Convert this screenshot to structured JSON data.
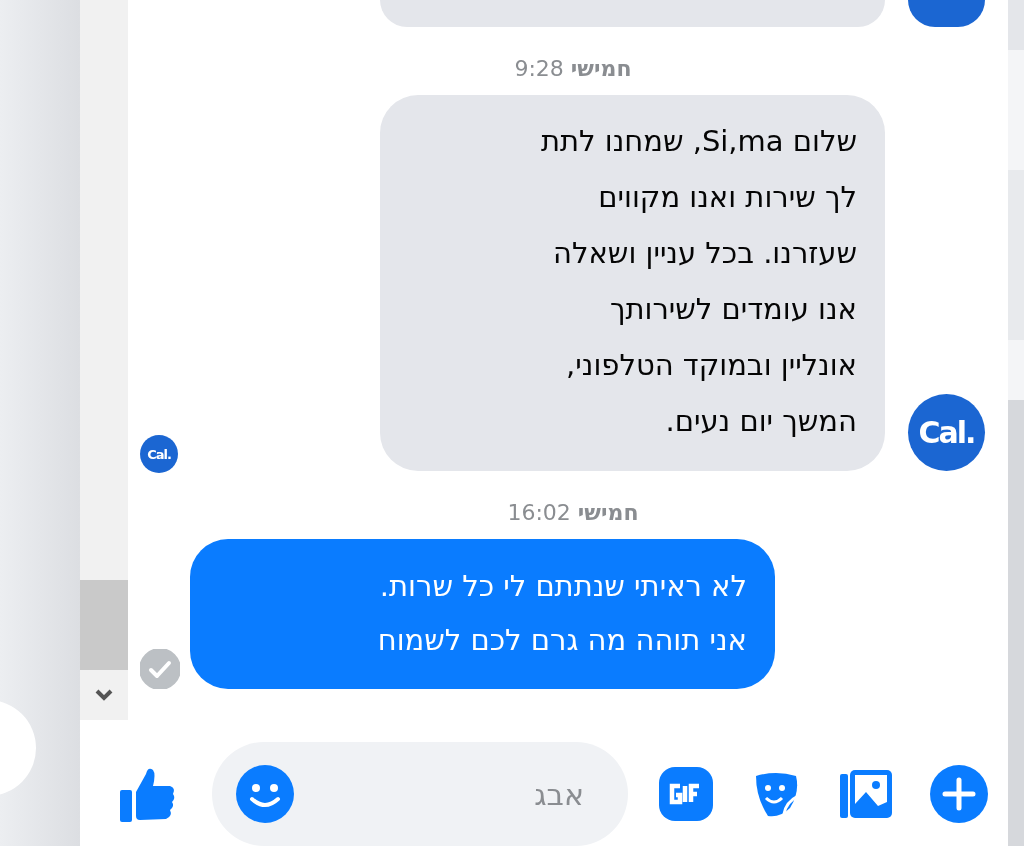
{
  "messages": [
    {
      "kind": "incoming_cut"
    },
    {
      "kind": "timestamp",
      "text": "**חמישי** 9:28"
    },
    {
      "kind": "incoming",
      "avatar": "Cal.",
      "seen_avatar": "Cal.",
      "lines": [
        "שלום Si,ma, שמחנו לתת",
        "לך שירות ואנו מקווים",
        "שעזרנו. בכל עניין ושאלה",
        "אנו עומדים לשירותך",
        "אונליין ובמוקד הטלפוני,",
        "המשך יום נעים."
      ]
    },
    {
      "kind": "timestamp",
      "text": "**חמישי** 16:02"
    },
    {
      "kind": "outgoing",
      "delivered": true,
      "lines": [
        "לא ראיתי שנתתם לי כל שרות.",
        "אני תוהה מה גרם לכם לשמוח"
      ]
    }
  ],
  "composer": {
    "placeholder": "אבג"
  }
}
